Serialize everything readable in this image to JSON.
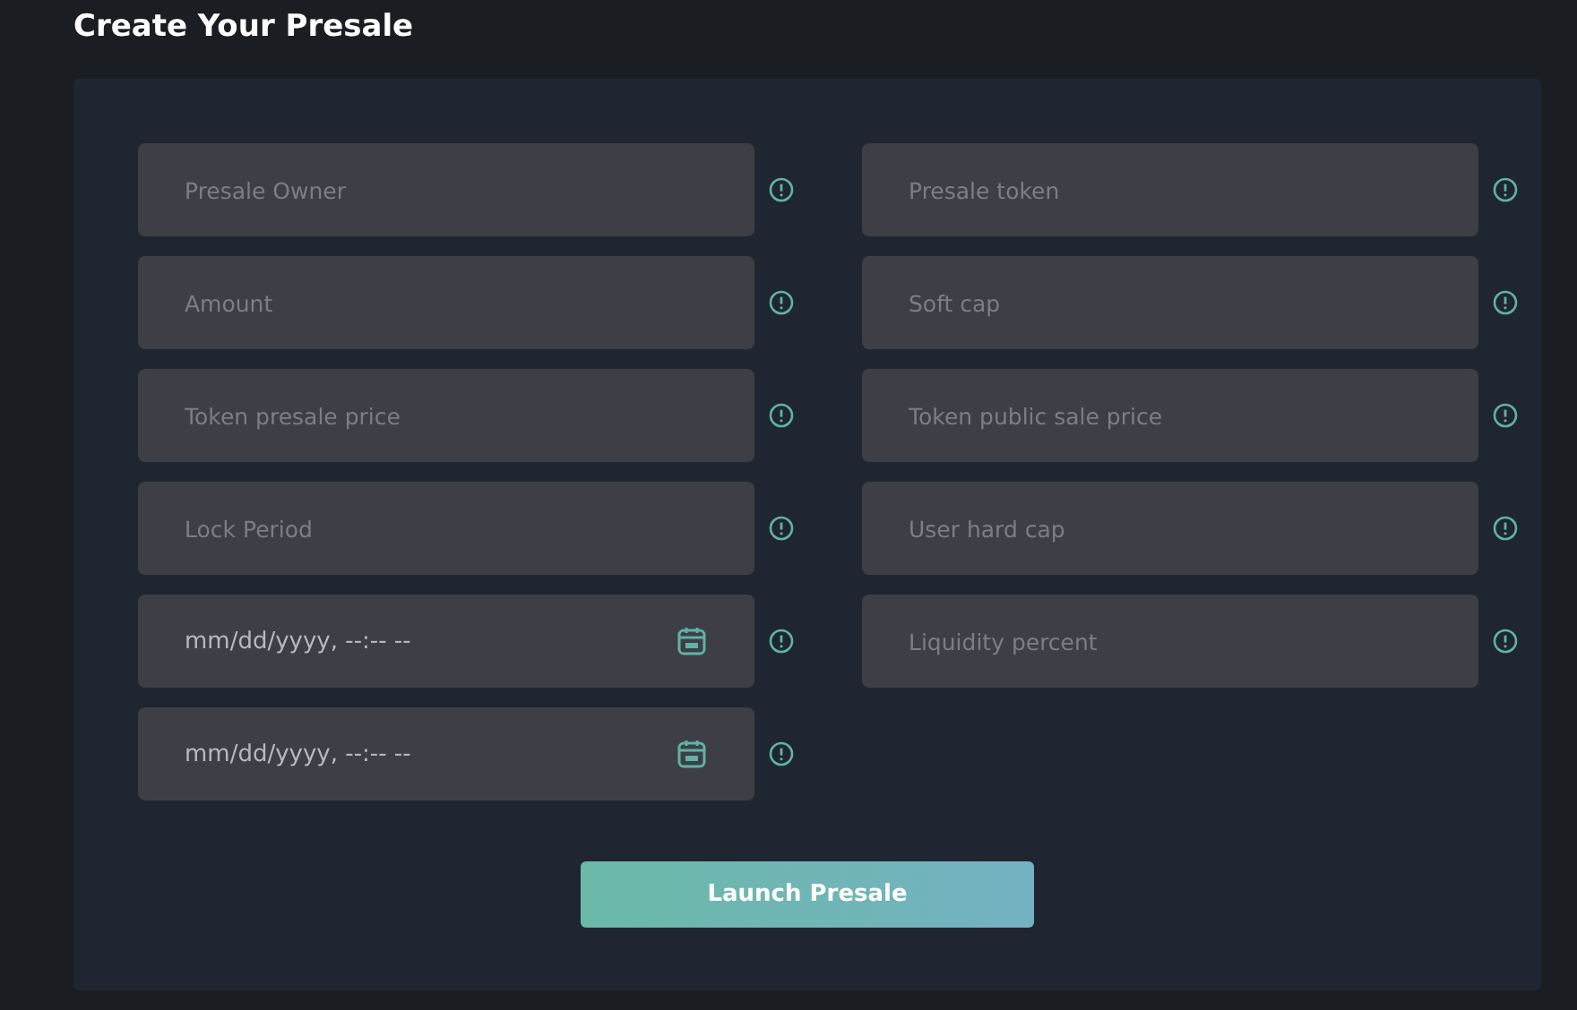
{
  "title": "Create Your Presale",
  "columns": [
    {
      "fields": [
        {
          "kind": "text",
          "placeholder": "Presale Owner"
        },
        {
          "kind": "text",
          "placeholder": "Amount"
        },
        {
          "kind": "text",
          "placeholder": "Token presale price"
        },
        {
          "kind": "text",
          "placeholder": "Lock Period"
        },
        {
          "kind": "datetime",
          "placeholder": "mm/dd/yyyy, --:-- --"
        },
        {
          "kind": "datetime",
          "placeholder": "mm/dd/yyyy, --:-- --"
        }
      ]
    },
    {
      "fields": [
        {
          "kind": "text",
          "placeholder": "Presale token"
        },
        {
          "kind": "text",
          "placeholder": "Soft cap"
        },
        {
          "kind": "text",
          "placeholder": "Token public sale price"
        },
        {
          "kind": "text",
          "placeholder": "User hard cap"
        },
        {
          "kind": "text",
          "placeholder": "Liquidity percent"
        }
      ]
    }
  ],
  "button": "Launch Presale"
}
